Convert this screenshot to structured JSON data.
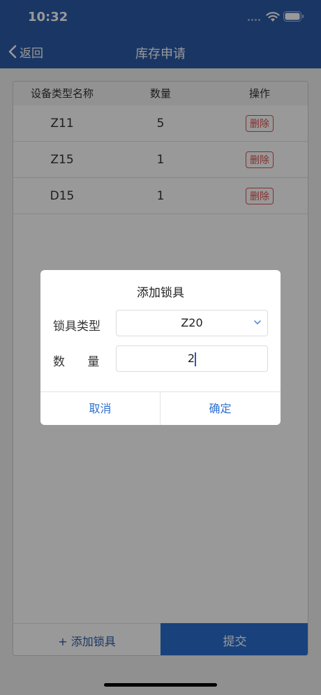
{
  "status": {
    "time": "10:32"
  },
  "nav": {
    "back_label": "返回",
    "title": "库存申请"
  },
  "table": {
    "headers": [
      "设备类型名称",
      "数量",
      "操作"
    ],
    "rows": [
      {
        "name": "Z11",
        "qty": "5",
        "action": "删除"
      },
      {
        "name": "Z15",
        "qty": "1",
        "action": "删除"
      },
      {
        "name": "D15",
        "qty": "1",
        "action": "删除"
      }
    ]
  },
  "bottom": {
    "add_label": "+ 添加锁具",
    "submit_label": "提交"
  },
  "dialog": {
    "title": "添加锁具",
    "type_label": "锁具类型",
    "type_value": "Z20",
    "qty_label": "数      量",
    "qty_value": "2",
    "cancel_label": "取消",
    "confirm_label": "确定"
  },
  "colors": {
    "brand": "#2b5aa8",
    "accent": "#2b6fd0",
    "danger": "#d9534f"
  }
}
